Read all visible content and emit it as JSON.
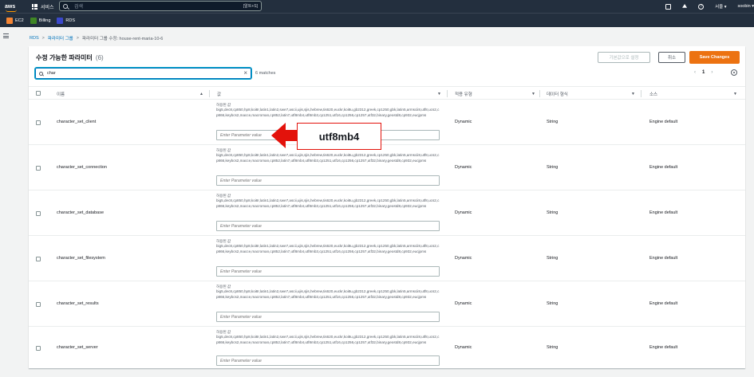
{
  "topbar": {
    "logo": "aws",
    "services_label": "서비스",
    "search_placeholder": "검색",
    "search_shortcut": "[알트+S]",
    "region": "서울 ▾",
    "user": "soobin ▾"
  },
  "favorites": [
    {
      "label": "EC2",
      "icon": "ec2-icon"
    },
    {
      "label": "Billing",
      "icon": "billing-icon"
    },
    {
      "label": "RDS",
      "icon": "rds-icon"
    }
  ],
  "breadcrumb": {
    "items": [
      "RDS",
      "파라미터 그룹",
      "파라미터 그룹 수정: house-rent-maria-10-6"
    ],
    "separator": ">"
  },
  "panel": {
    "title": "수정 가능한 파라미터",
    "count": "(6)",
    "reset_button": "기본값으로 설정",
    "cancel_button": "취소",
    "save_button": "Save Changes",
    "filter_value": "char",
    "matches": "6 matches",
    "page": "1",
    "prev": "‹",
    "next": "›"
  },
  "columns": {
    "name": "이름",
    "value": "값",
    "apply_type": "적용 유형",
    "data_type": "데이터 형식",
    "source": "소스"
  },
  "rows": [
    {
      "name": "character_set_client",
      "allowed_header": "허용된 값",
      "allowed": "big5,dec8,cp850,hp8,koi8r,latin1,latin2,swe7,ascii,ujis,sjis,hebrew,tis620,euckr,koi8u,gb2312,greek,cp1250,gbk,latin5,armscii8,utf8,ucs2,cp866,keybcs2,macce,macroman,cp852,latin7,utf8mb4,utf8mb3,cp1251,utf16,cp1256,cp1257,utf32,binary,geostd8,cp932,eucjpms",
      "placeholder": "Enter Parameter value",
      "apply_type": "Dynamic",
      "data_type": "String",
      "source": "Engine default"
    },
    {
      "name": "character_set_connection",
      "allowed_header": "허용된 값",
      "allowed": "big5,dec8,cp850,hp8,koi8r,latin1,latin2,swe7,ascii,ujis,sjis,hebrew,tis620,euckr,koi8u,gb2312,greek,cp1250,gbk,latin5,armscii8,utf8,ucs2,cp866,keybcs2,macce,macroman,cp852,latin7,utf8mb4,utf8mb3,cp1251,utf16,cp1256,cp1257,utf32,binary,geostd8,cp932,eucjpms",
      "placeholder": "Enter Parameter value",
      "apply_type": "Dynamic",
      "data_type": "String",
      "source": "Engine default"
    },
    {
      "name": "character_set_database",
      "allowed_header": "허용된 값",
      "allowed": "big5,dec8,cp850,hp8,koi8r,latin1,latin2,swe7,ascii,ujis,sjis,hebrew,tis620,euckr,koi8u,gb2312,greek,cp1250,gbk,latin5,armscii8,utf8,ucs2,cp866,keybcs2,macce,macroman,cp852,latin7,utf8mb4,utf8mb3,cp1251,utf16,cp1256,cp1257,utf32,binary,geostd8,cp932,eucjpms",
      "placeholder": "Enter Parameter value",
      "apply_type": "Dynamic",
      "data_type": "String",
      "source": "Engine default"
    },
    {
      "name": "character_set_filesystem",
      "allowed_header": "허용된 값",
      "allowed": "big5,dec8,cp850,hp8,koi8r,latin1,latin2,swe7,ascii,ujis,sjis,hebrew,tis620,euckr,koi8u,gb2312,greek,cp1250,gbk,latin5,armscii8,utf8,ucs2,cp866,keybcs2,macce,macroman,cp852,latin7,utf8mb4,utf8mb3,cp1251,utf16,cp1256,cp1257,utf32,binary,geostd8,cp932,eucjpms",
      "placeholder": "Enter Parameter value",
      "apply_type": "Dynamic",
      "data_type": "String",
      "source": "Engine default"
    },
    {
      "name": "character_set_results",
      "allowed_header": "허용된 값",
      "allowed": "big5,dec8,cp850,hp8,koi8r,latin1,latin2,swe7,ascii,ujis,sjis,hebrew,tis620,euckr,koi8u,gb2312,greek,cp1250,gbk,latin5,armscii8,utf8,ucs2,cp866,keybcs2,macce,macroman,cp852,latin7,utf8mb4,utf8mb3,cp1251,utf16,cp1256,cp1257,utf32,binary,geostd8,cp932,eucjpms",
      "placeholder": "Enter Parameter value",
      "apply_type": "Dynamic",
      "data_type": "String",
      "source": "Engine default"
    },
    {
      "name": "character_set_server",
      "allowed_header": "허용된 값",
      "allowed": "big5,dec8,cp850,hp8,koi8r,latin1,latin2,swe7,ascii,ujis,sjis,hebrew,tis620,euckr,koi8u,gb2312,greek,cp1250,gbk,latin5,armscii8,utf8,ucs2,cp866,keybcs2,macce,macroman,cp852,latin7,utf8mb4,utf8mb3,cp1251,utf16,cp1256,cp1257,utf32,binary,geostd8,cp932,eucjpms",
      "placeholder": "Enter Parameter value",
      "apply_type": "Dynamic",
      "data_type": "String",
      "source": "Engine default"
    }
  ],
  "annotation": {
    "label": "utf8mb4",
    "color": "#e3120b"
  },
  "colors": {
    "nav_bg": "#232f3e",
    "accent": "#ec7211",
    "link": "#0073bb"
  }
}
